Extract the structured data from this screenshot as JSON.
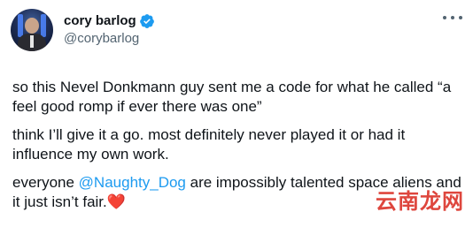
{
  "user": {
    "display_name": "cory barlog",
    "handle": "@corybarlog",
    "verified": true
  },
  "tweet": {
    "paragraph_1": "so this Nevel Donkmann guy sent me a code for what he called “a feel good romp if ever there was one”",
    "paragraph_2": "think I’ll give it a go. most definitely never played it or had it influence my own work.",
    "paragraph_3_before": "everyone ",
    "paragraph_3_mention": "@Naughty_Dog",
    "paragraph_3_after": " are impossibly talented space aliens and it just isn’t fair.",
    "emoji": "❤️"
  },
  "watermark": {
    "text": "云南龙网"
  },
  "colors": {
    "text": "#0f1419",
    "secondary": "#536471",
    "accent": "#1d9bf0",
    "heart": "#e0245e",
    "watermark": "#d9261c"
  },
  "icons": {
    "verified": "verified-badge-icon",
    "more": "more-options-icon",
    "heart": "red-heart-emoji"
  }
}
